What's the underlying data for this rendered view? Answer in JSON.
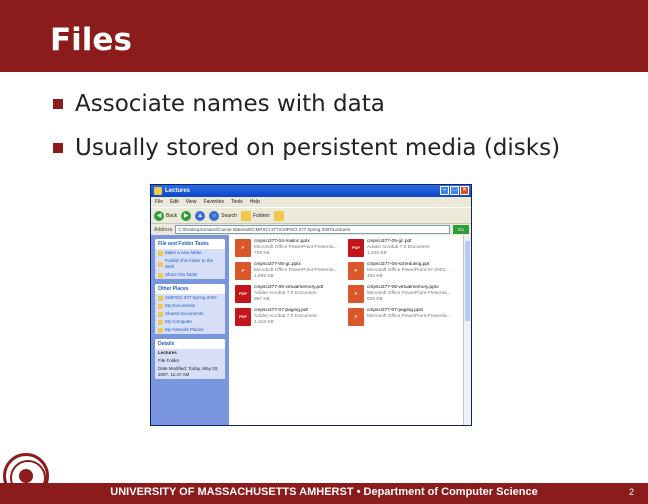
{
  "slide": {
    "title": "Files",
    "bullets": [
      "Associate names with data",
      "Usually stored on persistent media (disks)"
    ],
    "footer": "UNIVERSITY OF MASSACHUSETTS AMHERST • Department of Computer Science",
    "page_number": "2"
  },
  "window": {
    "title": "Lectures",
    "menu": [
      "File",
      "Edit",
      "View",
      "Favorites",
      "Tools",
      "Help"
    ],
    "toolbar": {
      "back": "Back",
      "search": "Search",
      "folders": "Folders"
    },
    "address": {
      "label": "Address",
      "value": "C:\\Desktop\\Umass\\Course Materials\\CMPSCI 377\\CMPSCI 377 Spring 2007\\Lectures",
      "go": "Go"
    },
    "tasks": {
      "file_tasks": {
        "heading": "File and Folder Tasks",
        "items": [
          "Make a new folder",
          "Publish this folder to the Web",
          "Share this folder"
        ]
      },
      "other_places": {
        "heading": "Other Places",
        "items": [
          "CMPSCI 377 Spring 2007",
          "My Documents",
          "Shared Documents",
          "My Computer",
          "My Network Places"
        ]
      },
      "details": {
        "heading": "Details",
        "name": "Lectures",
        "type": "File Folder",
        "modified": "Date Modified: Today, May 03, 2007, 11:47 AM"
      }
    },
    "files": [
      {
        "name": "cmpsci377-04-malloc.pptx",
        "type": "Microsoft Office PowerPoint Presenta...",
        "size": "729 KB",
        "kind": "ppt"
      },
      {
        "name": "cmpsci377-05-gc.pdf",
        "type": "Adobe Acrobat 7.0 Document",
        "size": "1,045 KB",
        "kind": "pdf"
      },
      {
        "name": "cmpsci377-05-gc.pptx",
        "type": "Microsoft Office PowerPoint Presenta...",
        "size": "1,696 KB",
        "kind": "ppt"
      },
      {
        "name": "cmpsci377-06-scheduling.ppt",
        "type": "Microsoft Office PowerPoint 97-2003...",
        "size": "456 KB",
        "kind": "ppt"
      },
      {
        "name": "cmpsci377-06-virtualmemory.pdf",
        "type": "Adobe Acrobat 7.0 Document",
        "size": "957 KB",
        "kind": "pdf"
      },
      {
        "name": "cmpsci377-06-virtualmemory.pptx",
        "type": "Microsoft Office PowerPoint Presenta...",
        "size": "629 KB",
        "kind": "ppt"
      },
      {
        "name": "cmpsci377-07-paging.pdf",
        "type": "Adobe Acrobat 7.0 Document",
        "size": "1,316 KB",
        "kind": "pdf"
      },
      {
        "name": "cmpsci377-07-paging.pptx",
        "type": "Microsoft Office PowerPoint Presenta...",
        "size": "",
        "kind": "ppt"
      }
    ]
  }
}
